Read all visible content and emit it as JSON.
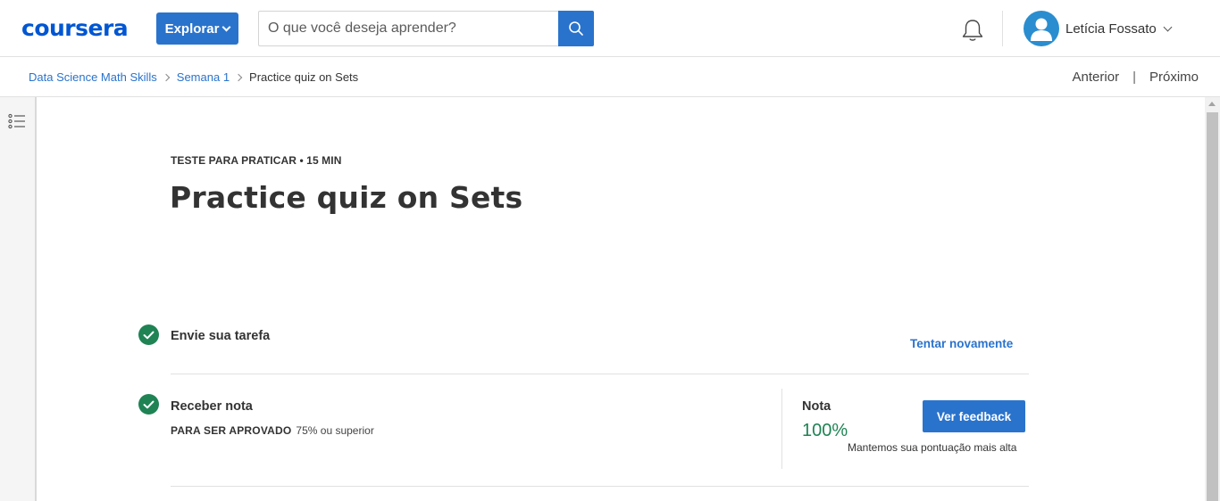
{
  "header": {
    "logo_text": "coursera",
    "explore_label": "Explorar",
    "search_placeholder": "O que você deseja aprender?",
    "user_name": "Letícia Fossato"
  },
  "breadcrumb": {
    "items": [
      "Data Science Math Skills",
      "Semana 1",
      "Practice quiz on Sets"
    ]
  },
  "pager": {
    "previous": "Anterior",
    "separator": "|",
    "next": "Próximo"
  },
  "quiz": {
    "eyebrow": "TESTE PARA PRATICAR • 15 MIN",
    "title": "Practice quiz on Sets",
    "steps": [
      {
        "title": "Envie sua tarefa",
        "status": "done",
        "action": "Tentar novamente"
      },
      {
        "title": "Receber nota",
        "status": "done"
      }
    ],
    "pass_label": "PARA SER APROVADO",
    "pass_value": "75% ou superior",
    "grade_label": "Nota",
    "grade_value": "100%",
    "feedback_button": "Ver feedback",
    "keep_note": "Mantemos sua pontuação mais alta"
  },
  "colors": {
    "brand_blue": "#0056d2",
    "button_blue": "#2a73cc",
    "success_green": "#1f8354"
  },
  "icons": [
    "chevron-down-icon",
    "search-icon",
    "bell-icon",
    "user-avatar-icon",
    "chevron-right-icon",
    "list-menu-icon",
    "checkmark-icon"
  ]
}
